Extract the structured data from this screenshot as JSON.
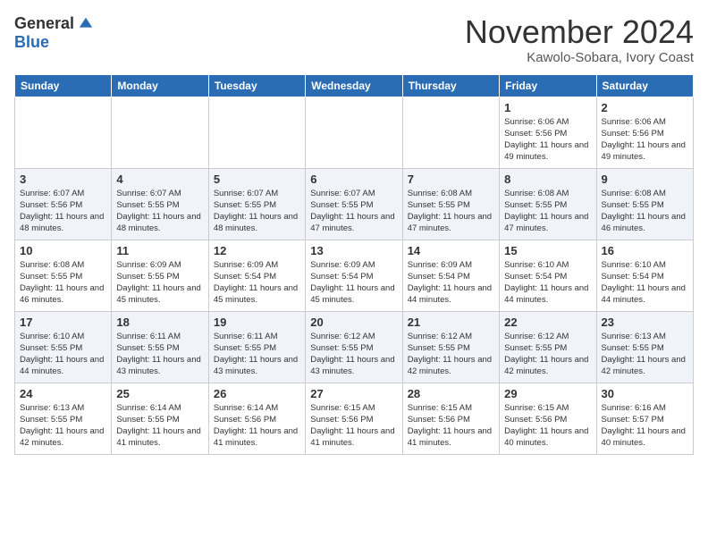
{
  "logo": {
    "general": "General",
    "blue": "Blue"
  },
  "header": {
    "month": "November 2024",
    "location": "Kawolo-Sobara, Ivory Coast"
  },
  "weekdays": [
    "Sunday",
    "Monday",
    "Tuesday",
    "Wednesday",
    "Thursday",
    "Friday",
    "Saturday"
  ],
  "weeks": [
    [
      {
        "day": "",
        "info": ""
      },
      {
        "day": "",
        "info": ""
      },
      {
        "day": "",
        "info": ""
      },
      {
        "day": "",
        "info": ""
      },
      {
        "day": "",
        "info": ""
      },
      {
        "day": "1",
        "info": "Sunrise: 6:06 AM\nSunset: 5:56 PM\nDaylight: 11 hours and 49 minutes."
      },
      {
        "day": "2",
        "info": "Sunrise: 6:06 AM\nSunset: 5:56 PM\nDaylight: 11 hours and 49 minutes."
      }
    ],
    [
      {
        "day": "3",
        "info": "Sunrise: 6:07 AM\nSunset: 5:56 PM\nDaylight: 11 hours and 48 minutes."
      },
      {
        "day": "4",
        "info": "Sunrise: 6:07 AM\nSunset: 5:55 PM\nDaylight: 11 hours and 48 minutes."
      },
      {
        "day": "5",
        "info": "Sunrise: 6:07 AM\nSunset: 5:55 PM\nDaylight: 11 hours and 48 minutes."
      },
      {
        "day": "6",
        "info": "Sunrise: 6:07 AM\nSunset: 5:55 PM\nDaylight: 11 hours and 47 minutes."
      },
      {
        "day": "7",
        "info": "Sunrise: 6:08 AM\nSunset: 5:55 PM\nDaylight: 11 hours and 47 minutes."
      },
      {
        "day": "8",
        "info": "Sunrise: 6:08 AM\nSunset: 5:55 PM\nDaylight: 11 hours and 47 minutes."
      },
      {
        "day": "9",
        "info": "Sunrise: 6:08 AM\nSunset: 5:55 PM\nDaylight: 11 hours and 46 minutes."
      }
    ],
    [
      {
        "day": "10",
        "info": "Sunrise: 6:08 AM\nSunset: 5:55 PM\nDaylight: 11 hours and 46 minutes."
      },
      {
        "day": "11",
        "info": "Sunrise: 6:09 AM\nSunset: 5:55 PM\nDaylight: 11 hours and 45 minutes."
      },
      {
        "day": "12",
        "info": "Sunrise: 6:09 AM\nSunset: 5:54 PM\nDaylight: 11 hours and 45 minutes."
      },
      {
        "day": "13",
        "info": "Sunrise: 6:09 AM\nSunset: 5:54 PM\nDaylight: 11 hours and 45 minutes."
      },
      {
        "day": "14",
        "info": "Sunrise: 6:09 AM\nSunset: 5:54 PM\nDaylight: 11 hours and 44 minutes."
      },
      {
        "day": "15",
        "info": "Sunrise: 6:10 AM\nSunset: 5:54 PM\nDaylight: 11 hours and 44 minutes."
      },
      {
        "day": "16",
        "info": "Sunrise: 6:10 AM\nSunset: 5:54 PM\nDaylight: 11 hours and 44 minutes."
      }
    ],
    [
      {
        "day": "17",
        "info": "Sunrise: 6:10 AM\nSunset: 5:55 PM\nDaylight: 11 hours and 44 minutes."
      },
      {
        "day": "18",
        "info": "Sunrise: 6:11 AM\nSunset: 5:55 PM\nDaylight: 11 hours and 43 minutes."
      },
      {
        "day": "19",
        "info": "Sunrise: 6:11 AM\nSunset: 5:55 PM\nDaylight: 11 hours and 43 minutes."
      },
      {
        "day": "20",
        "info": "Sunrise: 6:12 AM\nSunset: 5:55 PM\nDaylight: 11 hours and 43 minutes."
      },
      {
        "day": "21",
        "info": "Sunrise: 6:12 AM\nSunset: 5:55 PM\nDaylight: 11 hours and 42 minutes."
      },
      {
        "day": "22",
        "info": "Sunrise: 6:12 AM\nSunset: 5:55 PM\nDaylight: 11 hours and 42 minutes."
      },
      {
        "day": "23",
        "info": "Sunrise: 6:13 AM\nSunset: 5:55 PM\nDaylight: 11 hours and 42 minutes."
      }
    ],
    [
      {
        "day": "24",
        "info": "Sunrise: 6:13 AM\nSunset: 5:55 PM\nDaylight: 11 hours and 42 minutes."
      },
      {
        "day": "25",
        "info": "Sunrise: 6:14 AM\nSunset: 5:55 PM\nDaylight: 11 hours and 41 minutes."
      },
      {
        "day": "26",
        "info": "Sunrise: 6:14 AM\nSunset: 5:56 PM\nDaylight: 11 hours and 41 minutes."
      },
      {
        "day": "27",
        "info": "Sunrise: 6:15 AM\nSunset: 5:56 PM\nDaylight: 11 hours and 41 minutes."
      },
      {
        "day": "28",
        "info": "Sunrise: 6:15 AM\nSunset: 5:56 PM\nDaylight: 11 hours and 41 minutes."
      },
      {
        "day": "29",
        "info": "Sunrise: 6:15 AM\nSunset: 5:56 PM\nDaylight: 11 hours and 40 minutes."
      },
      {
        "day": "30",
        "info": "Sunrise: 6:16 AM\nSunset: 5:57 PM\nDaylight: 11 hours and 40 minutes."
      }
    ]
  ]
}
